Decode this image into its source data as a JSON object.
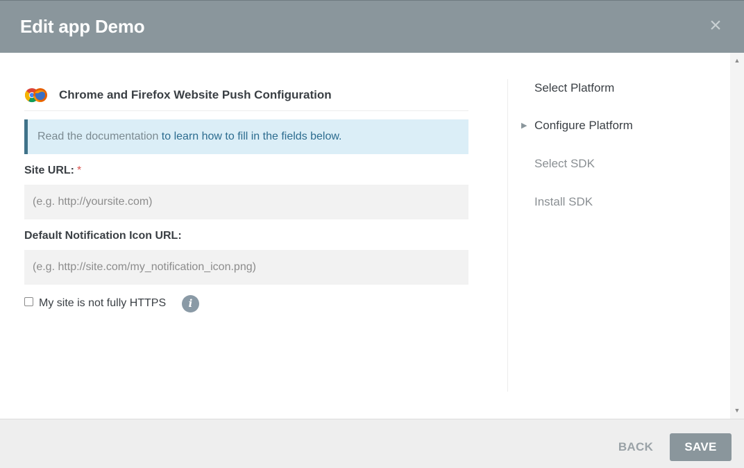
{
  "dialog": {
    "title": "Edit app Demo",
    "close_symbol": "×"
  },
  "section": {
    "title": "Chrome and Firefox Website Push Configuration",
    "icon": "chrome-firefox-icon"
  },
  "info_box": {
    "muted_text": "Read the documentation ",
    "link_text": "to learn how to fill in the fields below."
  },
  "fields": {
    "site_url": {
      "label": "Site URL:",
      "required_mark": "*",
      "placeholder": "(e.g. http://yoursite.com)",
      "value": ""
    },
    "icon_url": {
      "label": "Default Notification Icon URL:",
      "placeholder": "(e.g. http://site.com/my_notification_icon.png)",
      "value": ""
    }
  },
  "https_option": {
    "label": "My site is not fully HTTPS",
    "checked": false,
    "info_symbol": "i"
  },
  "steps": [
    {
      "label": "Select Platform",
      "state": "done"
    },
    {
      "label": "Configure Platform",
      "state": "active"
    },
    {
      "label": "Select SDK",
      "state": "todo"
    },
    {
      "label": "Install SDK",
      "state": "todo"
    }
  ],
  "footer": {
    "back_label": "BACK",
    "save_label": "SAVE"
  },
  "colors": {
    "header_bg": "#8a969c",
    "info_bg": "#dbeef7",
    "info_border": "#3f7289",
    "link": "#2c6c8f",
    "required": "#d9534f"
  }
}
